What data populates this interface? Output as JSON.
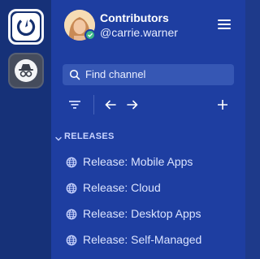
{
  "header": {
    "team_name": "Contributors",
    "username": "@carrie.warner"
  },
  "search": {
    "placeholder": "Find channel"
  },
  "sections": [
    {
      "label": "RELEASES",
      "channels": [
        {
          "name": "Release: Mobile Apps",
          "icon": "globe-icon"
        },
        {
          "name": "Release: Cloud",
          "icon": "globe-icon"
        },
        {
          "name": "Release: Desktop Apps",
          "icon": "globe-icon"
        },
        {
          "name": "Release: Self-Managed",
          "icon": "globe-icon"
        }
      ]
    }
  ],
  "colors": {
    "team_rail": "#163178",
    "sidebar": "#1e3ea1",
    "online_status": "#3db887",
    "search_bg": "#3657b4"
  }
}
